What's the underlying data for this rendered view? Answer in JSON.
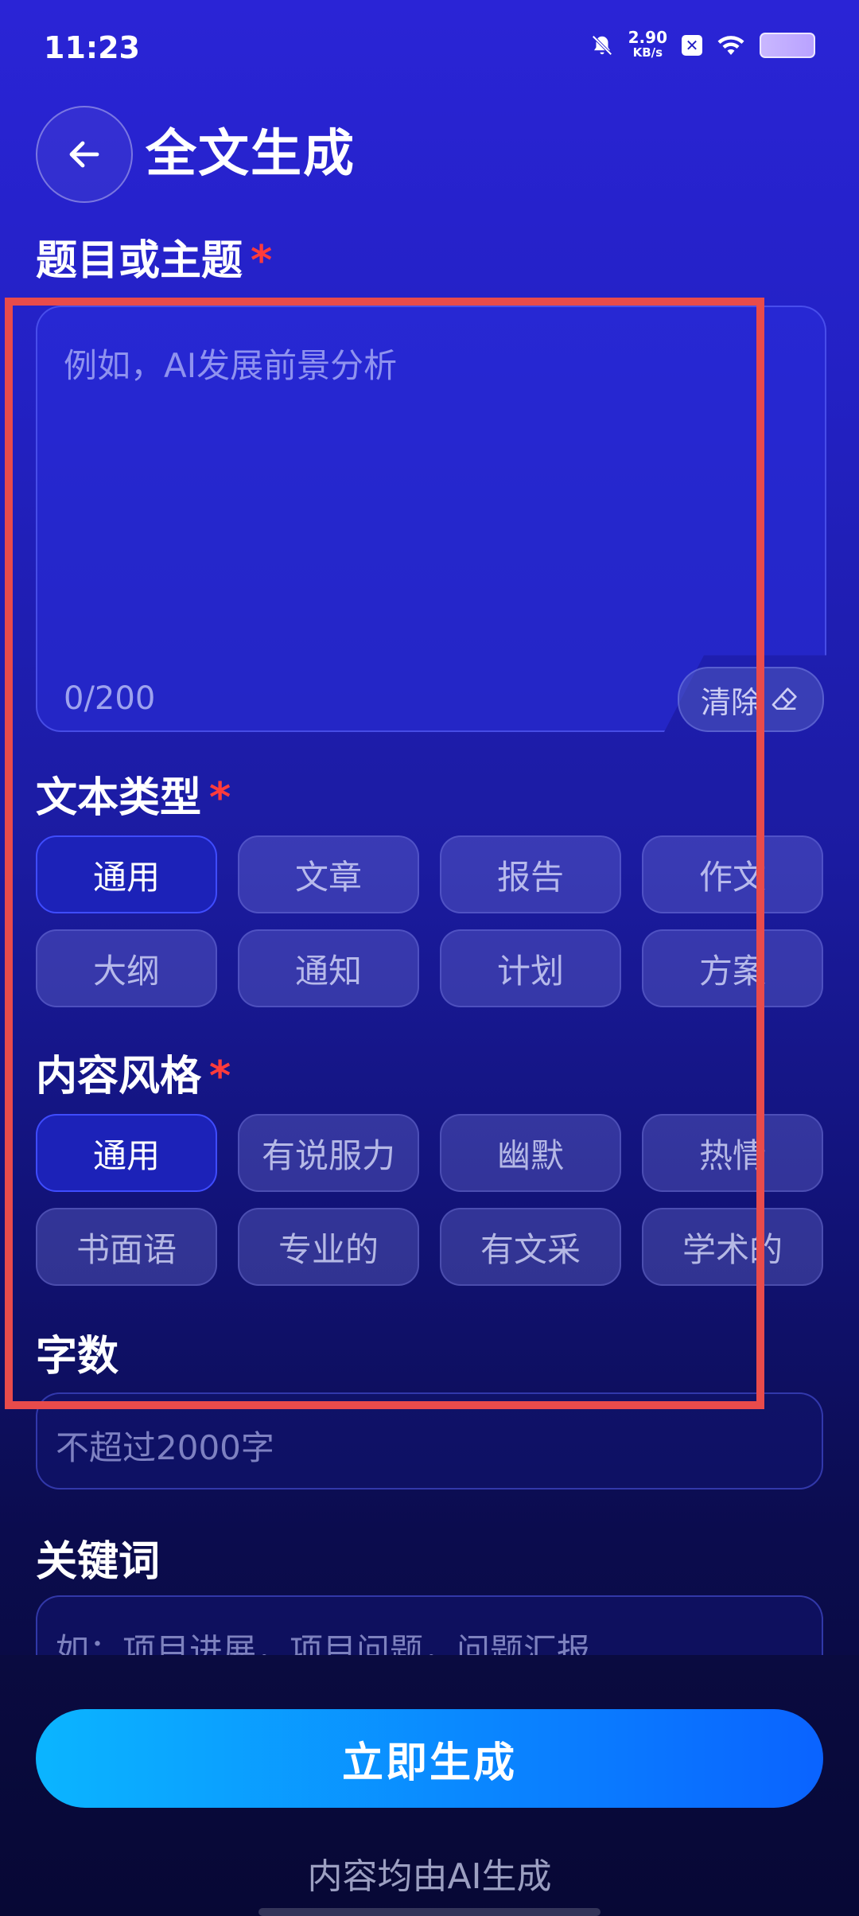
{
  "status_bar": {
    "time": "11:23",
    "net_speed": "2.90",
    "net_unit": "KB/s"
  },
  "header": {
    "title": "全文生成"
  },
  "topic": {
    "label": "题目或主题",
    "required": "*",
    "placeholder": "例如，AI发展前景分析",
    "counter": "0/200",
    "clear_label": "清除"
  },
  "text_type": {
    "label": "文本类型",
    "required": "*",
    "options": [
      "通用",
      "文章",
      "报告",
      "作文",
      "大纲",
      "通知",
      "计划",
      "方案"
    ],
    "selected": "通用"
  },
  "style": {
    "label": "内容风格",
    "required": "*",
    "options": [
      "通用",
      "有说服力",
      "幽默",
      "热情",
      "书面语",
      "专业的",
      "有文采",
      "学术的"
    ],
    "selected": "通用"
  },
  "word_count": {
    "label": "字数",
    "placeholder": "不超过2000字"
  },
  "keywords": {
    "label": "关键词",
    "placeholder": "如：项目进展，项目问题，问题汇报"
  },
  "generate": {
    "label": "立即生成"
  },
  "footer": {
    "note": "内容均由AI生成"
  },
  "colors": {
    "accent_start": "#0bb5ff",
    "accent_end": "#0a63ff",
    "required_star": "#ff3b3b",
    "highlight_box": "#e84b4b"
  }
}
